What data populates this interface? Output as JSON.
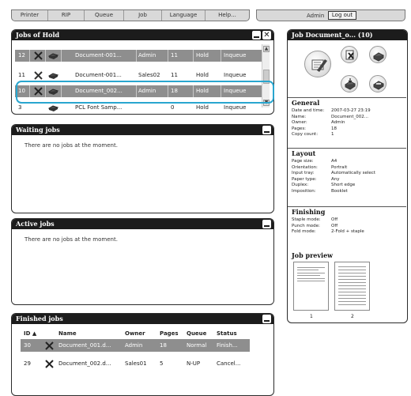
{
  "menu": {
    "items": [
      "Printer",
      "RIP",
      "Queue",
      "Job",
      "Language",
      "Help..."
    ]
  },
  "account": {
    "user": "Admin",
    "logout": "Log out"
  },
  "hold_panel": {
    "title": "Jobs of Hold",
    "rows": [
      {
        "id": "12",
        "name": "Document-001...",
        "owner": "Admin",
        "pages": "11",
        "status": "Hold",
        "queue": "Inqueue"
      },
      {
        "id": "11",
        "name": "Document-001...",
        "owner": "Sales02",
        "pages": "11",
        "status": "Hold",
        "queue": "Inqueue"
      },
      {
        "id": "10",
        "name": "Document_002...",
        "owner": "Admin",
        "pages": "18",
        "status": "Hold",
        "queue": "Inqueue"
      },
      {
        "id": "3",
        "name": "PCL Font Samp...",
        "owner": "",
        "pages": "0",
        "status": "Hold",
        "queue": "Inqueue"
      }
    ]
  },
  "waiting_panel": {
    "title": "Waiting jobs",
    "empty": "There are no jobs at the moment."
  },
  "active_panel": {
    "title": "Active jobs",
    "empty": "There are no jobs at the moment."
  },
  "finished_panel": {
    "title": "Finished jobs",
    "headers": {
      "id": "ID ▲",
      "name": "Name",
      "owner": "Owner",
      "pages": "Pages",
      "queue": "Queue",
      "status": "Status"
    },
    "rows": [
      {
        "id": "30",
        "name": "Document_001.d...",
        "owner": "Admin",
        "pages": "18",
        "queue": "Normal",
        "status": "Finish..."
      },
      {
        "id": "29",
        "name": "Document_002.d...",
        "owner": "Sales01",
        "pages": "5",
        "queue": "N-UP",
        "status": "Cancel..."
      }
    ]
  },
  "details": {
    "title": "Job Document_o... (10)",
    "general": {
      "heading": "General",
      "items": [
        {
          "k": "Date and time:",
          "v": "2007-03-27 23:19"
        },
        {
          "k": "Name:",
          "v": "Document_002..."
        },
        {
          "k": "Owner:",
          "v": "Admin"
        },
        {
          "k": "Pages:",
          "v": "18"
        },
        {
          "k": "Copy count:",
          "v": "1"
        }
      ]
    },
    "layout": {
      "heading": "Layout",
      "items": [
        {
          "k": "Page size:",
          "v": "A4"
        },
        {
          "k": "Orientation:",
          "v": "Portrait"
        },
        {
          "k": "Input tray:",
          "v": "Automatically select"
        },
        {
          "k": "Paper type:",
          "v": "Any"
        },
        {
          "k": "Duplex:",
          "v": "Short edge"
        },
        {
          "k": "Imposition:",
          "v": "Booklet"
        }
      ]
    },
    "finishing": {
      "heading": "Finishing",
      "items": [
        {
          "k": "Staple mode:",
          "v": "Off"
        },
        {
          "k": "Punch mode:",
          "v": "Off"
        },
        {
          "k": "Fold mode:",
          "v": "2-Fold + staple"
        }
      ]
    },
    "preview": {
      "heading": "Job preview",
      "pages": [
        "1",
        "2"
      ]
    }
  },
  "colors": {
    "accent": "#29a6cf",
    "header": "#1c1c1c",
    "selected_row": "#8e8e8e"
  }
}
